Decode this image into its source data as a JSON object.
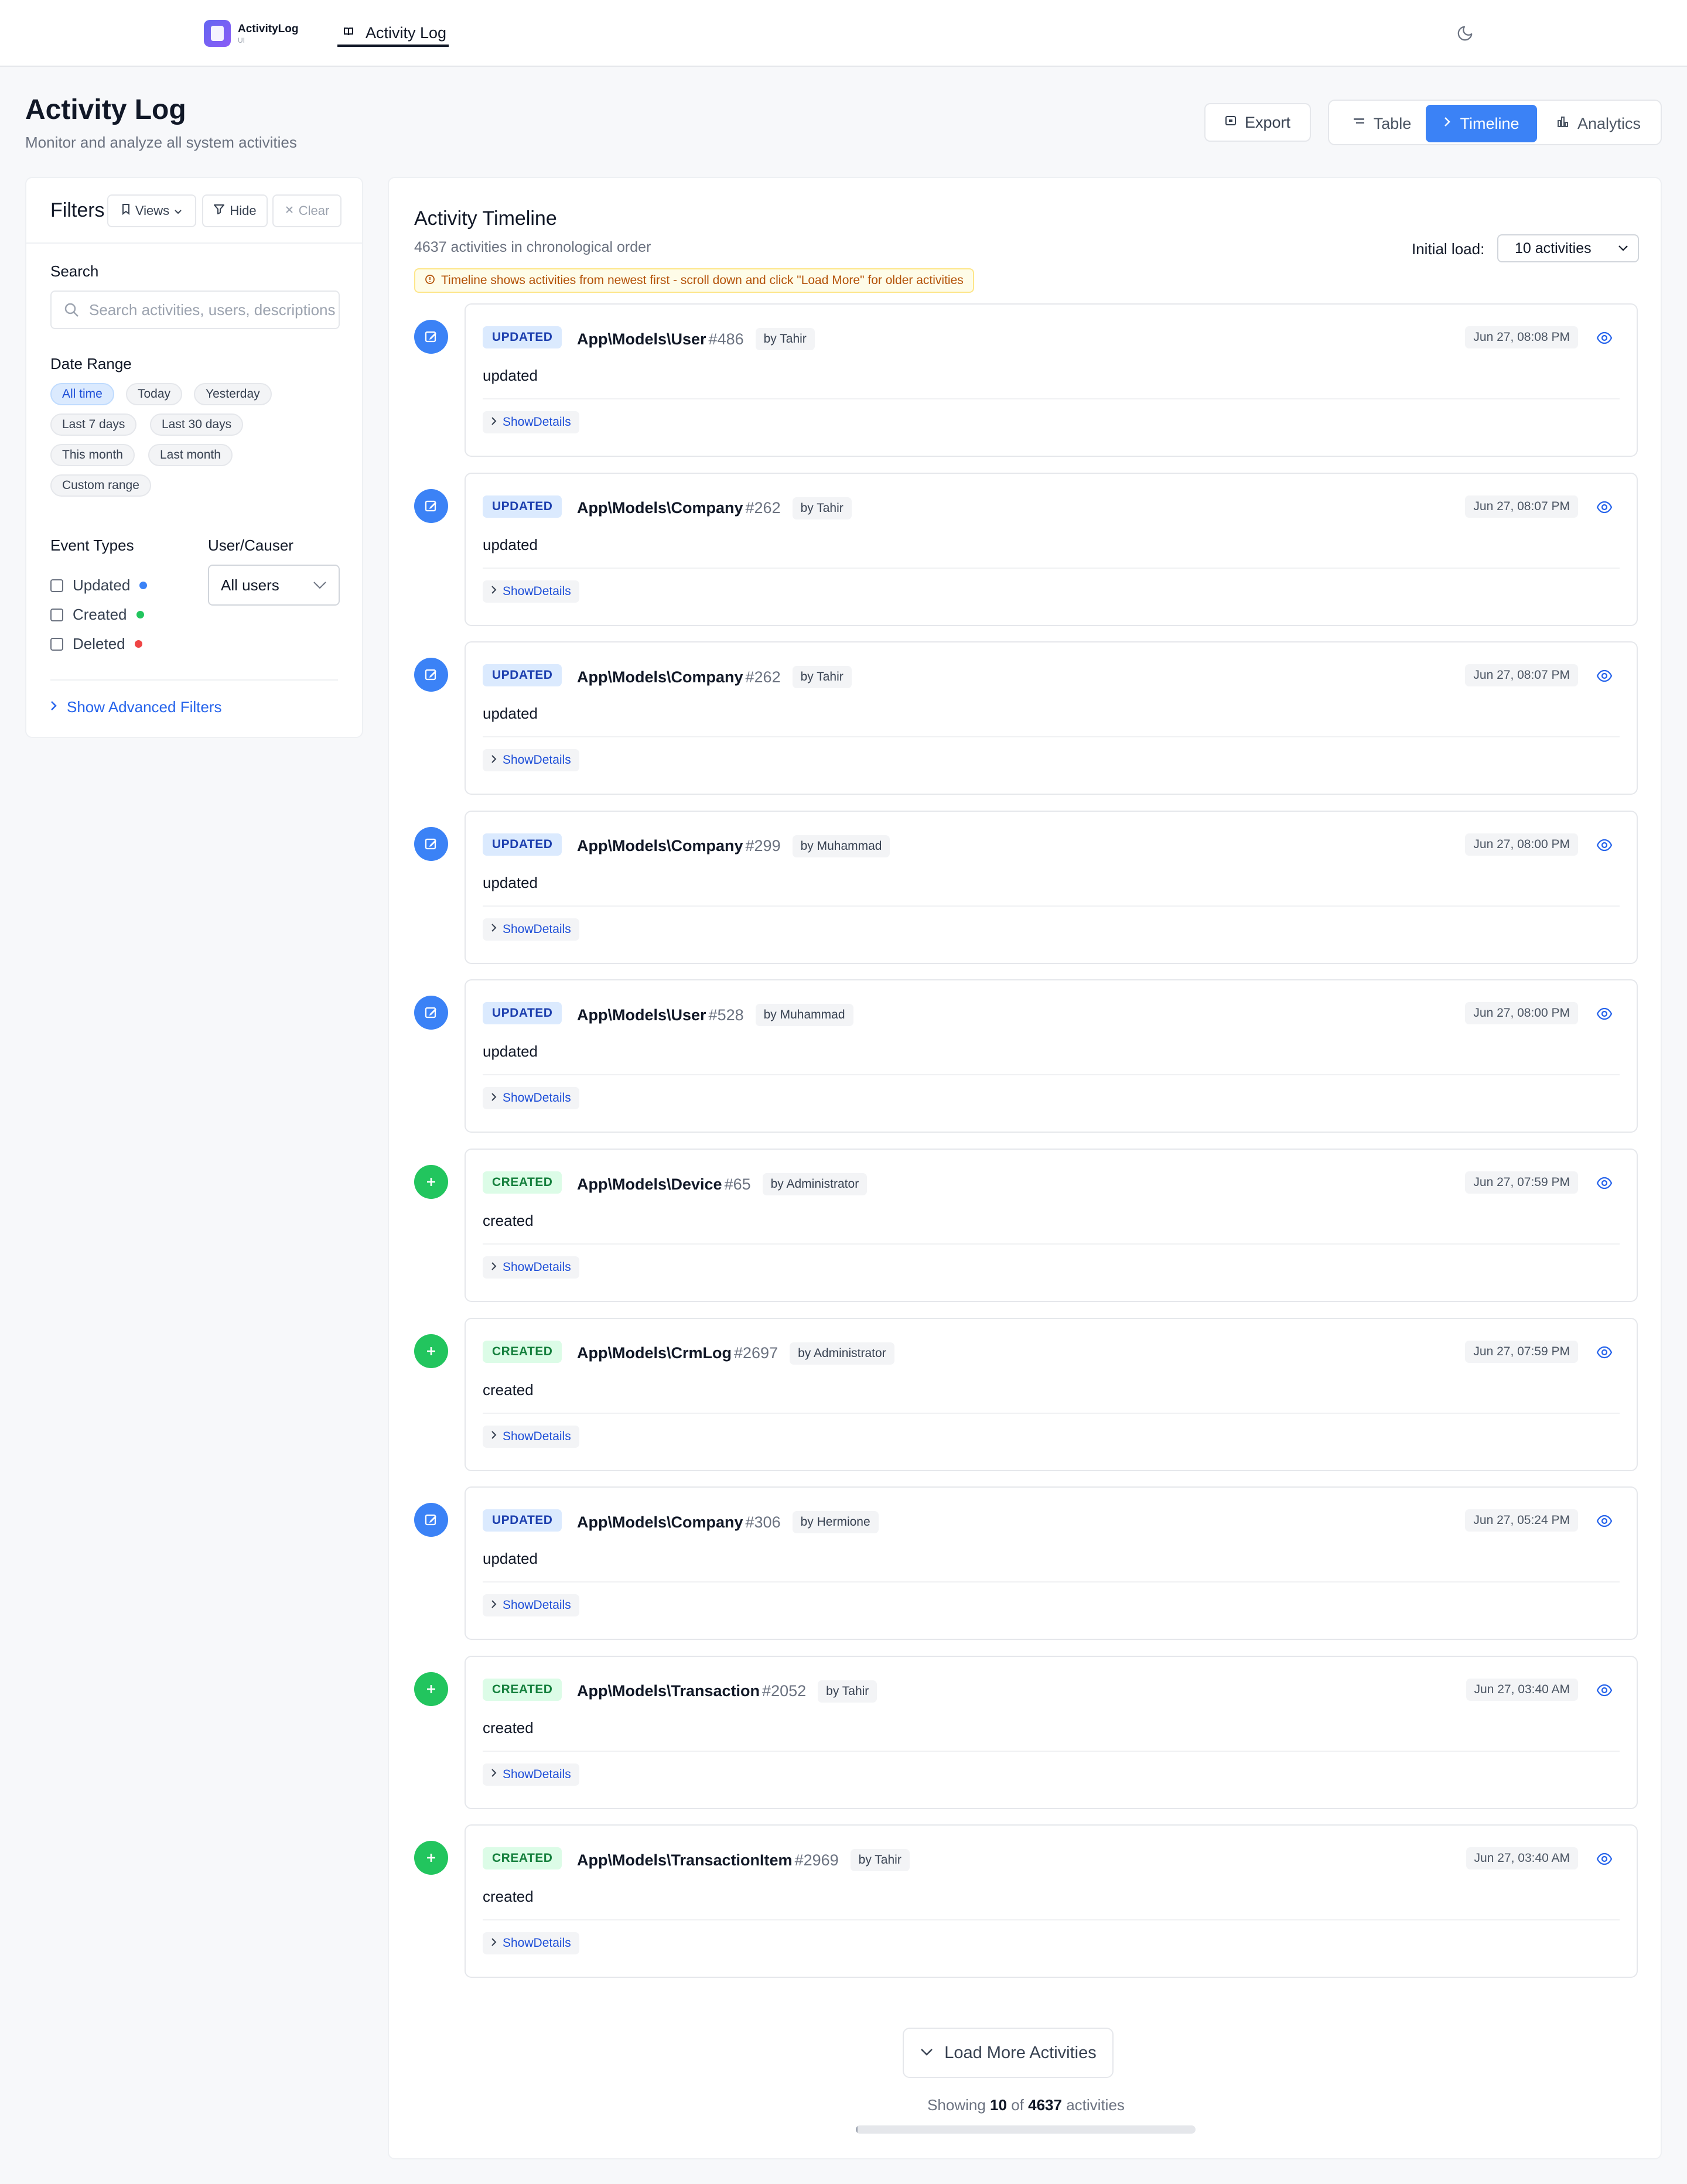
{
  "app": {
    "name": "ActivityLog",
    "sub": "UI"
  },
  "nav": {
    "tab_label": "Activity Log"
  },
  "header": {
    "title": "Activity Log",
    "subtitle": "Monitor and analyze all system activities",
    "export_label": "Export",
    "views": {
      "table": "Table",
      "timeline": "Timeline",
      "analytics": "Analytics"
    }
  },
  "filters": {
    "title": "Filters",
    "views_label": "Views",
    "hide_label": "Hide",
    "clear_label": "Clear",
    "search_label": "Search",
    "search_placeholder": "Search activities, users, descriptions...",
    "date_range_label": "Date Range",
    "date_options": [
      "All time",
      "Today",
      "Yesterday",
      "Last 7 days",
      "Last 30 days",
      "This month",
      "Last month",
      "Custom range"
    ],
    "date_selected": "All time",
    "event_types_label": "Event Types",
    "event_types": [
      {
        "label": "Updated",
        "color": "#3b82f6"
      },
      {
        "label": "Created",
        "color": "#22c55e"
      },
      {
        "label": "Deleted",
        "color": "#ef4444"
      }
    ],
    "user_label": "User/Causer",
    "user_selected": "All users",
    "advanced_label": "Show Advanced Filters"
  },
  "timeline": {
    "title": "Activity Timeline",
    "subtitle": "4637 activities in chronological order",
    "note": "Timeline shows activities from newest first - scroll down and click \"Load More\" for older activities",
    "initial_load_label": "Initial load:",
    "initial_load_value": "10 activities",
    "details_label": "ShowDetails",
    "items": [
      {
        "type": "updated",
        "badge": "UPDATED",
        "model": "App\\Models\\User",
        "id": "#486",
        "by": "by Tahir",
        "time": "Jun 27, 08:08 PM",
        "description": "updated"
      },
      {
        "type": "updated",
        "badge": "UPDATED",
        "model": "App\\Models\\Company",
        "id": "#262",
        "by": "by Tahir",
        "time": "Jun 27, 08:07 PM",
        "description": "updated"
      },
      {
        "type": "updated",
        "badge": "UPDATED",
        "model": "App\\Models\\Company",
        "id": "#262",
        "by": "by Tahir",
        "time": "Jun 27, 08:07 PM",
        "description": "updated"
      },
      {
        "type": "updated",
        "badge": "UPDATED",
        "model": "App\\Models\\Company",
        "id": "#299",
        "by": "by Muhammad",
        "time": "Jun 27, 08:00 PM",
        "description": "updated"
      },
      {
        "type": "updated",
        "badge": "UPDATED",
        "model": "App\\Models\\User",
        "id": "#528",
        "by": "by Muhammad",
        "time": "Jun 27, 08:00 PM",
        "description": "updated"
      },
      {
        "type": "created",
        "badge": "CREATED",
        "model": "App\\Models\\Device",
        "id": "#65",
        "by": "by Administrator",
        "time": "Jun 27, 07:59 PM",
        "description": "created"
      },
      {
        "type": "created",
        "badge": "CREATED",
        "model": "App\\Models\\CrmLog",
        "id": "#2697",
        "by": "by Administrator",
        "time": "Jun 27, 07:59 PM",
        "description": "created"
      },
      {
        "type": "updated",
        "badge": "UPDATED",
        "model": "App\\Models\\Company",
        "id": "#306",
        "by": "by Hermione",
        "time": "Jun 27, 05:24 PM",
        "description": "updated"
      },
      {
        "type": "created",
        "badge": "CREATED",
        "model": "App\\Models\\Transaction",
        "id": "#2052",
        "by": "by Tahir",
        "time": "Jun 27, 03:40 AM",
        "description": "created"
      },
      {
        "type": "created",
        "badge": "CREATED",
        "model": "App\\Models\\TransactionItem",
        "id": "#2969",
        "by": "by Tahir",
        "time": "Jun 27, 03:40 AM",
        "description": "created"
      }
    ],
    "load_more_label": "Load More Activities",
    "showing": {
      "prefix": "Showing",
      "shown": "10",
      "of": "of",
      "total": "4637",
      "suffix": "activities"
    },
    "progress_fraction": 0.0022
  }
}
